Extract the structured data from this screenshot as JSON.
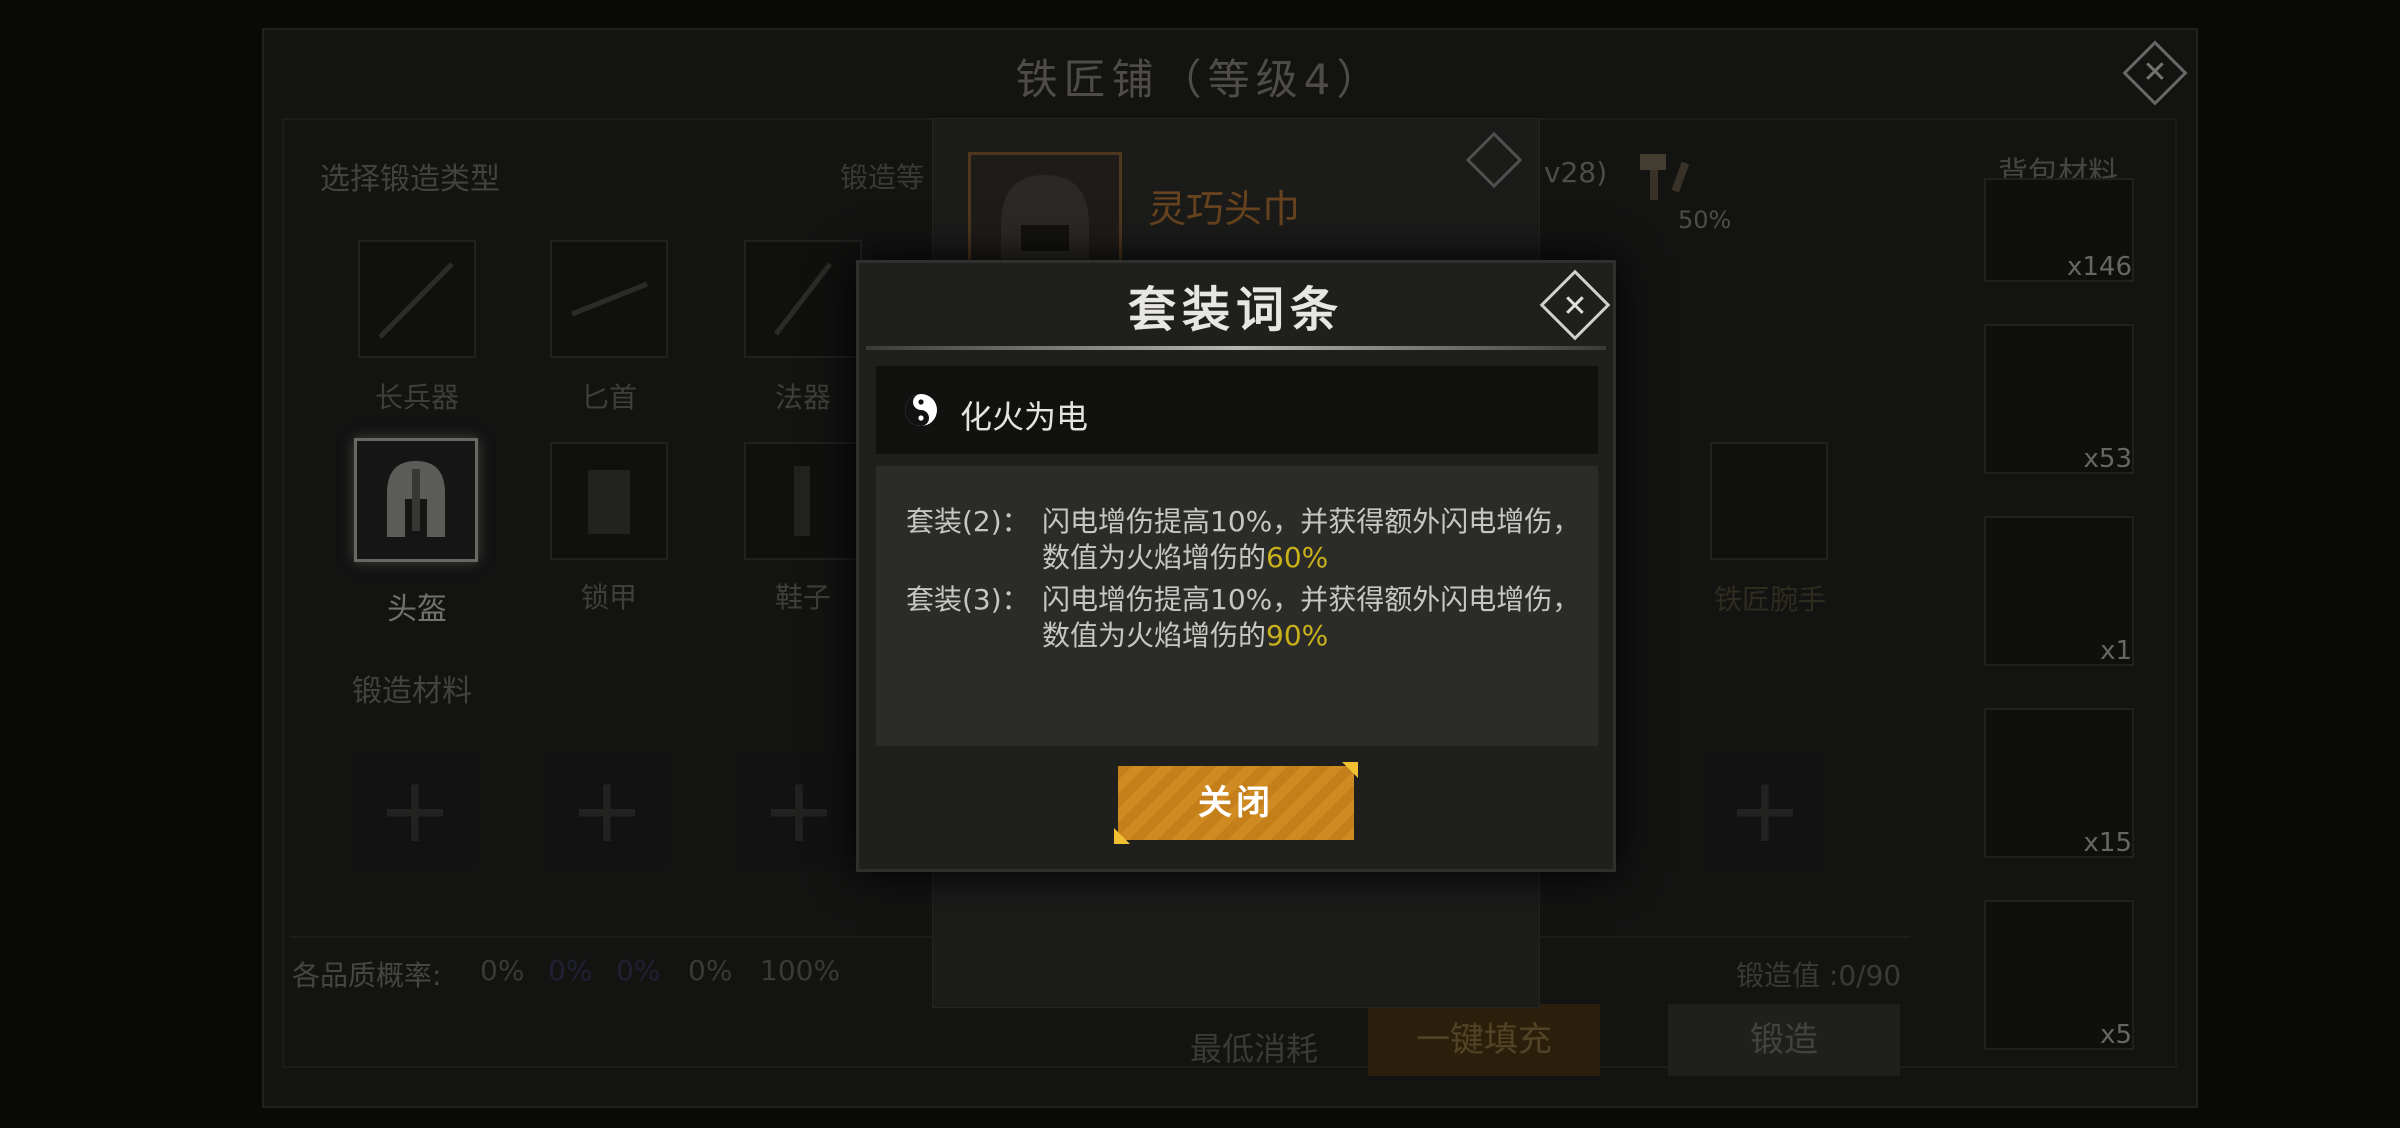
{
  "shop": {
    "title": "铁匠铺（等级4）",
    "select_type_label": "选择锻造类型",
    "forge_level_label": "锻造等",
    "level_fragment": "v28)",
    "percent_label": "50%",
    "bag_label": "背包材料",
    "weapon_types": [
      {
        "label": "长兵器"
      },
      {
        "label": "匕首"
      },
      {
        "label": "法器"
      }
    ],
    "armor_types": [
      {
        "label": "头盔",
        "selected": true
      },
      {
        "label": "锁甲"
      },
      {
        "label": "鞋子"
      },
      {
        "label": "铁匠腕手"
      }
    ],
    "materials_label": "锻造材料",
    "quality_label": "各品质概率:",
    "quality_values": [
      "0%",
      "0%",
      "0%",
      "0%",
      "100%"
    ],
    "forge_value_label": "锻造值 :0/90",
    "min_cost_label": "最低消耗",
    "autofill_button": "一键填充",
    "forge_button": "锻造",
    "bag_items": [
      {
        "count": "x146"
      },
      {
        "count": "x53"
      },
      {
        "count": "x1"
      },
      {
        "count": "x15"
      },
      {
        "count": "x5"
      }
    ]
  },
  "item_card": {
    "name": "灵巧头巾"
  },
  "modal": {
    "title": "套装词条",
    "set_name": "化火为电",
    "bonuses": [
      {
        "tier": "套装(2)：",
        "line1": "闪电增伤提高10%，并获得额外闪电增伤，",
        "line2_prefix": "数值为火焰增伤的",
        "line2_value": "60%"
      },
      {
        "tier": "套装(3)：",
        "line1": "闪电增伤提高10%，并获得额外闪电增伤，",
        "line2_prefix": "数值为火焰增伤的",
        "line2_value": "90%"
      }
    ],
    "close_button": "关闭"
  },
  "icons": [
    "close-icon",
    "yin-yang-icon",
    "helmet-icon",
    "hammer-icon",
    "plus-icon"
  ],
  "colors": {
    "accent": "#d08a22",
    "highlight": "#c9b11a",
    "item_name": "#8a5a2a"
  }
}
